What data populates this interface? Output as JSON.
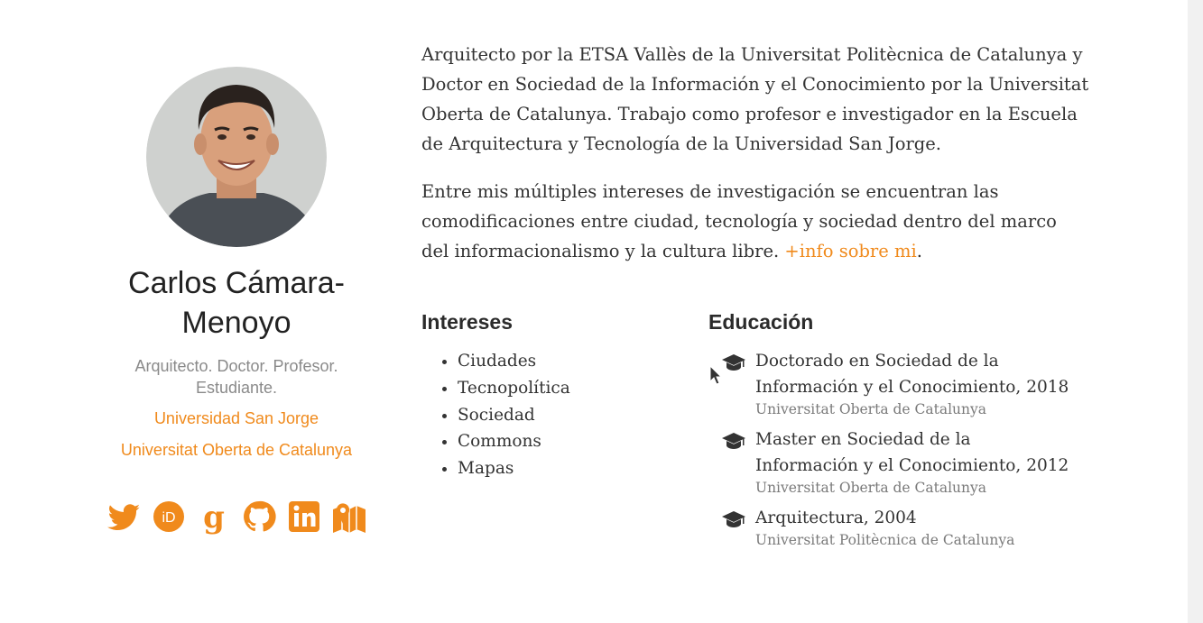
{
  "profile": {
    "name": "Carlos Cámara-Menoyo",
    "tagline": "Arquitecto. Doctor. Profesor. Estudiante.",
    "organizations": [
      "Universidad San Jorge",
      "Universitat Oberta de Catalunya"
    ],
    "social_icons": [
      "twitter-icon",
      "orcid-icon",
      "google-scholar-icon",
      "github-icon",
      "linkedin-icon",
      "map-icon"
    ]
  },
  "bio": {
    "paragraph1": "Arquitecto por la ETSA Vallès de la Universitat Politècnica de Catalunya y Doctor en Sociedad de la Información y el Conocimiento por la Universitat Oberta de Catalunya. Trabajo como profesor e investigador en la Escuela de Arquitectura y Tecnología de la Universidad San Jorge.",
    "paragraph2": "Entre mis múltiples intereses de investigación se encuentran las comodificaciones entre ciudad, tecnología y sociedad dentro del marco del informacionalismo y la cultura libre.",
    "more_link": "+info sobre mi",
    "trailing": "."
  },
  "interests": {
    "title": "Intereses",
    "items": [
      "Ciudades",
      "Tecnopolítica",
      "Sociedad",
      "Commons",
      "Mapas"
    ]
  },
  "education": {
    "title": "Educación",
    "items": [
      {
        "degree": "Doctorado en Sociedad de la Información y el Conocimiento, 2018",
        "institution": "Universitat Oberta de Catalunya"
      },
      {
        "degree": "Master en Sociedad de la Información y el Conocimiento, 2012",
        "institution": "Universitat Oberta de Catalunya"
      },
      {
        "degree": "Arquitectura, 2004",
        "institution": "Universitat Politècnica de Catalunya"
      }
    ]
  },
  "colors": {
    "accent": "#f08a1c",
    "text": "#333333",
    "muted": "#8a8a8a"
  }
}
